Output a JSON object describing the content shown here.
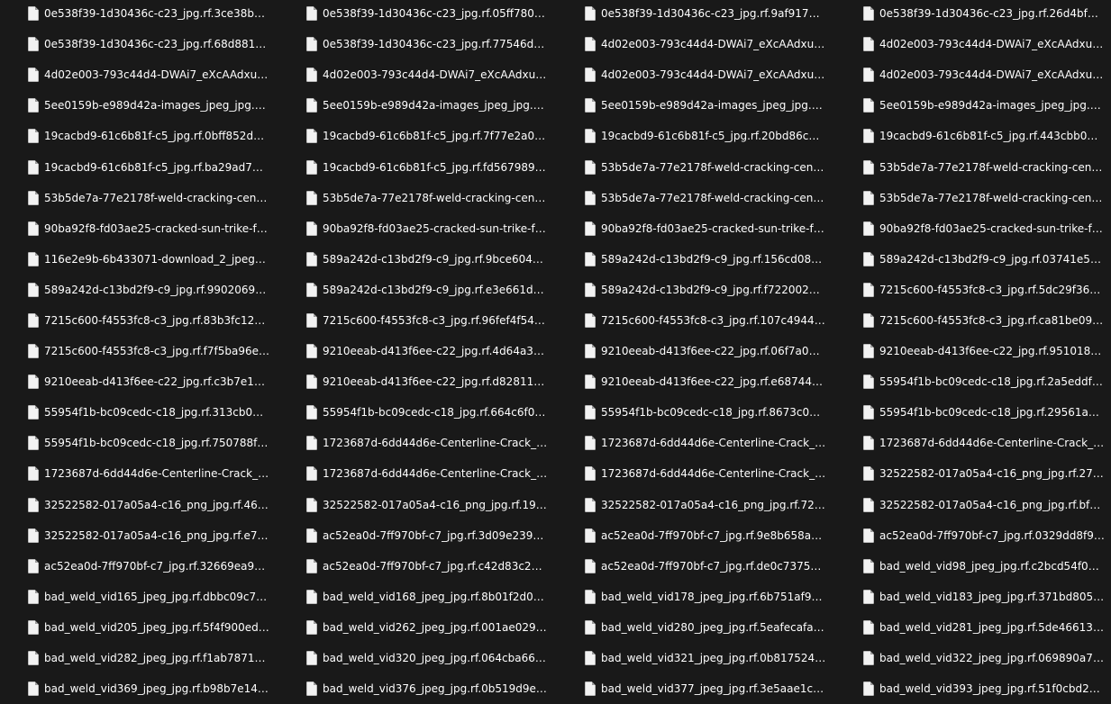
{
  "file_list": {
    "icon": "document-file-icon",
    "colors": {
      "background": "#191919",
      "text": "#ffffff",
      "icon_fill": "#f2f2f2",
      "icon_fold": "#9a9a9a"
    },
    "items": [
      {
        "name": "0e538f39-1d30436c-c23_jpg.rf.3ce38b0e..."
      },
      {
        "name": "0e538f39-1d30436c-c23_jpg.rf.05ff78024..."
      },
      {
        "name": "0e538f39-1d30436c-c23_jpg.rf.9af91763a..."
      },
      {
        "name": "0e538f39-1d30436c-c23_jpg.rf.26d4bf7a3..."
      },
      {
        "name": "0e538f39-1d30436c-c23_jpg.rf.68d88152..."
      },
      {
        "name": "0e538f39-1d30436c-c23_jpg.rf.77546dd3..."
      },
      {
        "name": "4d02e003-793c44d4-DWAi7_eXcAAdxuF_j..."
      },
      {
        "name": "4d02e003-793c44d4-DWAi7_eXcAAdxuF_j..."
      },
      {
        "name": "4d02e003-793c44d4-DWAi7_eXcAAdxuF_j..."
      },
      {
        "name": "4d02e003-793c44d4-DWAi7_eXcAAdxuF_j..."
      },
      {
        "name": "4d02e003-793c44d4-DWAi7_eXcAAdxuF_j..."
      },
      {
        "name": "4d02e003-793c44d4-DWAi7_eXcAAdxuF_j..."
      },
      {
        "name": "5ee0159b-e989d42a-images_jpeg_jpg.rf...."
      },
      {
        "name": "5ee0159b-e989d42a-images_jpeg_jpg.rf...."
      },
      {
        "name": "5ee0159b-e989d42a-images_jpeg_jpg.rf...."
      },
      {
        "name": "5ee0159b-e989d42a-images_jpeg_jpg.rf...."
      },
      {
        "name": "19cacbd9-61c6b81f-c5_jpg.rf.0bff852db9..."
      },
      {
        "name": "19cacbd9-61c6b81f-c5_jpg.rf.7f77e2a05f..."
      },
      {
        "name": "19cacbd9-61c6b81f-c5_jpg.rf.20bd86c8ef..."
      },
      {
        "name": "19cacbd9-61c6b81f-c5_jpg.rf.443cbb0b6..."
      },
      {
        "name": "19cacbd9-61c6b81f-c5_jpg.rf.ba29ad7bb..."
      },
      {
        "name": "19cacbd9-61c6b81f-c5_jpg.rf.fd567989bc..."
      },
      {
        "name": "53b5de7a-77e2178f-weld-cracking-cente..."
      },
      {
        "name": "53b5de7a-77e2178f-weld-cracking-cente..."
      },
      {
        "name": "53b5de7a-77e2178f-weld-cracking-cente..."
      },
      {
        "name": "53b5de7a-77e2178f-weld-cracking-cente..."
      },
      {
        "name": "53b5de7a-77e2178f-weld-cracking-cente..."
      },
      {
        "name": "53b5de7a-77e2178f-weld-cracking-cente..."
      },
      {
        "name": "90ba92f8-fd03ae25-cracked-sun-trike-fr..."
      },
      {
        "name": "90ba92f8-fd03ae25-cracked-sun-trike-fr..."
      },
      {
        "name": "90ba92f8-fd03ae25-cracked-sun-trike-fr..."
      },
      {
        "name": "90ba92f8-fd03ae25-cracked-sun-trike-fr..."
      },
      {
        "name": "116e2e9b-6b433071-download_2_jpeg_j..."
      },
      {
        "name": "589a242d-c13bd2f9-c9_jpg.rf.9bce60421..."
      },
      {
        "name": "589a242d-c13bd2f9-c9_jpg.rf.156cd08a0f..."
      },
      {
        "name": "589a242d-c13bd2f9-c9_jpg.rf.03741e5d9..."
      },
      {
        "name": "589a242d-c13bd2f9-c9_jpg.rf.99020699c..."
      },
      {
        "name": "589a242d-c13bd2f9-c9_jpg.rf.e3e661d78..."
      },
      {
        "name": "589a242d-c13bd2f9-c9_jpg.rf.f722002ee6..."
      },
      {
        "name": "7215c600-f4553fc8-c3_jpg.rf.5dc29f36172..."
      },
      {
        "name": "7215c600-f4553fc8-c3_jpg.rf.83b3fc12561..."
      },
      {
        "name": "7215c600-f4553fc8-c3_jpg.rf.96fef4f5422..."
      },
      {
        "name": "7215c600-f4553fc8-c3_jpg.rf.107c49444a..."
      },
      {
        "name": "7215c600-f4553fc8-c3_jpg.rf.ca81be09fa5..."
      },
      {
        "name": "7215c600-f4553fc8-c3_jpg.rf.f7f5ba96effa..."
      },
      {
        "name": "9210eeab-d413f6ee-c22_jpg.rf.4d64a342..."
      },
      {
        "name": "9210eeab-d413f6ee-c22_jpg.rf.06f7a0ba..."
      },
      {
        "name": "9210eeab-d413f6ee-c22_jpg.rf.9510186b..."
      },
      {
        "name": "9210eeab-d413f6ee-c22_jpg.rf.c3b7e199..."
      },
      {
        "name": "9210eeab-d413f6ee-c22_jpg.rf.d82811bc..."
      },
      {
        "name": "9210eeab-d413f6ee-c22_jpg.rf.e687447d..."
      },
      {
        "name": "55954f1b-bc09cedc-c18_jpg.rf.2a5eddfc4..."
      },
      {
        "name": "55954f1b-bc09cedc-c18_jpg.rf.313cb055..."
      },
      {
        "name": "55954f1b-bc09cedc-c18_jpg.rf.664c6f01a..."
      },
      {
        "name": "55954f1b-bc09cedc-c18_jpg.rf.8673c0967..."
      },
      {
        "name": "55954f1b-bc09cedc-c18_jpg.rf.29561a87..."
      },
      {
        "name": "55954f1b-bc09cedc-c18_jpg.rf.750788f2e..."
      },
      {
        "name": "1723687d-6dd44d6e-Centerline-Crack_jp..."
      },
      {
        "name": "1723687d-6dd44d6e-Centerline-Crack_jp..."
      },
      {
        "name": "1723687d-6dd44d6e-Centerline-Crack_jp..."
      },
      {
        "name": "1723687d-6dd44d6e-Centerline-Crack_jp..."
      },
      {
        "name": "1723687d-6dd44d6e-Centerline-Crack_jp..."
      },
      {
        "name": "1723687d-6dd44d6e-Centerline-Crack_jp..."
      },
      {
        "name": "32522582-017a05a4-c16_png_jpg.rf.27a2..."
      },
      {
        "name": "32522582-017a05a4-c16_png_jpg.rf.46f2..."
      },
      {
        "name": "32522582-017a05a4-c16_png_jpg.rf.193f..."
      },
      {
        "name": "32522582-017a05a4-c16_png_jpg.rf.7245..."
      },
      {
        "name": "32522582-017a05a4-c16_png_jpg.rf.bf6e..."
      },
      {
        "name": "32522582-017a05a4-c16_png_jpg.rf.e72e..."
      },
      {
        "name": "ac52ea0d-7ff970bf-c7_jpg.rf.3d09e2391ff..."
      },
      {
        "name": "ac52ea0d-7ff970bf-c7_jpg.rf.9e8b658a02..."
      },
      {
        "name": "ac52ea0d-7ff970bf-c7_jpg.rf.0329dd8f90..."
      },
      {
        "name": "ac52ea0d-7ff970bf-c7_jpg.rf.32669ea9d8..."
      },
      {
        "name": "ac52ea0d-7ff970bf-c7_jpg.rf.c42d83c24e..."
      },
      {
        "name": "ac52ea0d-7ff970bf-c7_jpg.rf.de0c737541..."
      },
      {
        "name": "bad_weld_vid98_jpeg_jpg.rf.c2bcd54f0df2..."
      },
      {
        "name": "bad_weld_vid165_jpeg_jpg.rf.dbbc09c7b2..."
      },
      {
        "name": "bad_weld_vid168_jpeg_jpg.rf.8b01f2d0da..."
      },
      {
        "name": "bad_weld_vid178_jpeg_jpg.rf.6b751af9c1..."
      },
      {
        "name": "bad_weld_vid183_jpeg_jpg.rf.371bd805d..."
      },
      {
        "name": "bad_weld_vid205_jpeg_jpg.rf.5f4f900ed3c..."
      },
      {
        "name": "bad_weld_vid262_jpeg_jpg.rf.001ae0293b..."
      },
      {
        "name": "bad_weld_vid280_jpeg_jpg.rf.5eafecafa1e..."
      },
      {
        "name": "bad_weld_vid281_jpeg_jpg.rf.5de4661335..."
      },
      {
        "name": "bad_weld_vid282_jpeg_jpg.rf.f1ab787156..."
      },
      {
        "name": "bad_weld_vid320_jpeg_jpg.rf.064cba66d5..."
      },
      {
        "name": "bad_weld_vid321_jpeg_jpg.rf.0b817524df..."
      },
      {
        "name": "bad_weld_vid322_jpeg_jpg.rf.069890a7d7..."
      },
      {
        "name": "bad_weld_vid369_jpeg_jpg.rf.b98b7e1401..."
      },
      {
        "name": "bad_weld_vid376_jpeg_jpg.rf.0b519d9eb..."
      },
      {
        "name": "bad_weld_vid377_jpeg_jpg.rf.3e5aae1ce8..."
      },
      {
        "name": "bad_weld_vid393_jpeg_jpg.rf.51f0cbd291..."
      }
    ]
  }
}
